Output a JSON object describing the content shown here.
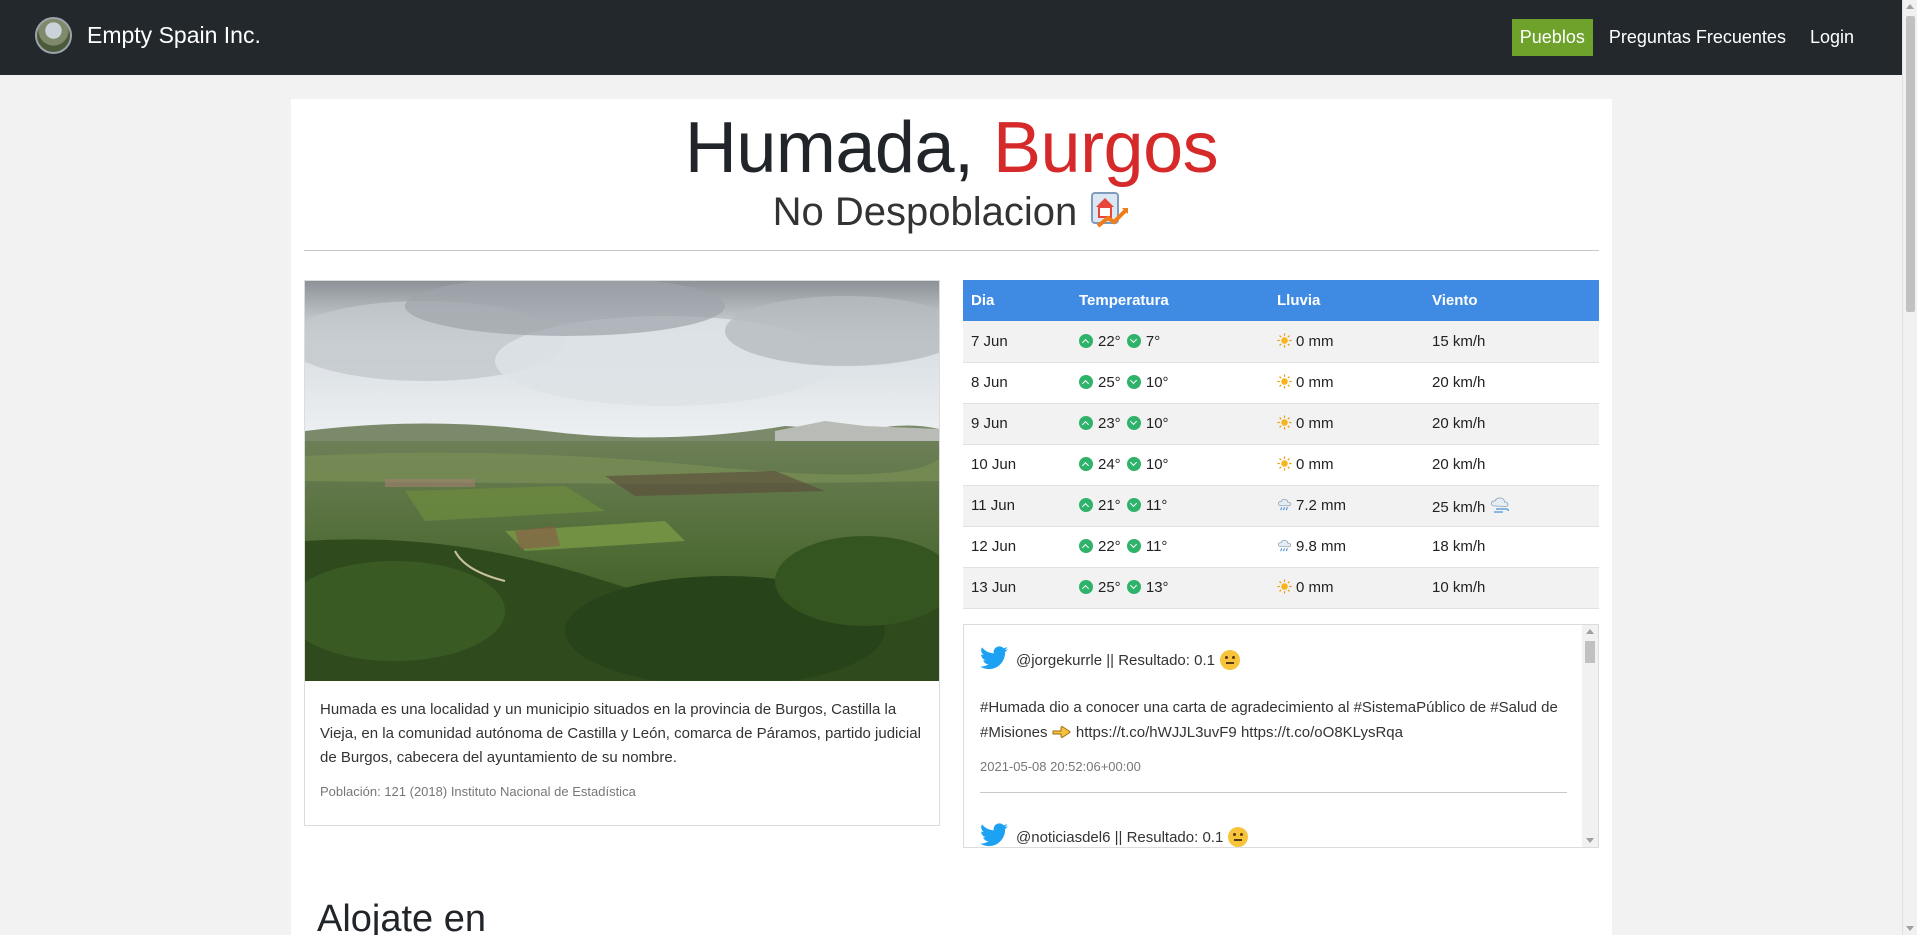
{
  "nav": {
    "brand": "Empty Spain Inc.",
    "links": [
      "Pueblos",
      "Preguntas Frecuentes",
      "Login"
    ]
  },
  "town": {
    "name": "Humada,",
    "province": "Burgos",
    "status": "No Despoblacion"
  },
  "card": {
    "description": "Humada es una localidad y un municipio situados en la provincia de Burgos, Castilla la Vieja, en la comunidad autónoma de Castilla y León, comarca de Páramos, partido judicial de Burgos, cabecera del ayuntamiento de su nombre.",
    "population": "Población: 121 (2018) Instituto Nacional de Estadística"
  },
  "weather": {
    "headers": [
      "Dia",
      "Temperatura",
      "Lluvia",
      "Viento"
    ],
    "rows": [
      {
        "day": "7 Jun",
        "max": "22°",
        "min": "7°",
        "rain": "0 mm",
        "rain_icon": "sun-icon",
        "wind": "15 km/h",
        "wind_icon": ""
      },
      {
        "day": "8 Jun",
        "max": "25°",
        "min": "10°",
        "rain": "0 mm",
        "rain_icon": "sun-icon",
        "wind": "20 km/h",
        "wind_icon": ""
      },
      {
        "day": "9 Jun",
        "max": "23°",
        "min": "10°",
        "rain": "0 mm",
        "rain_icon": "sun-icon",
        "wind": "20 km/h",
        "wind_icon": ""
      },
      {
        "day": "10 Jun",
        "max": "24°",
        "min": "10°",
        "rain": "0 mm",
        "rain_icon": "sun-icon",
        "wind": "20 km/h",
        "wind_icon": ""
      },
      {
        "day": "11 Jun",
        "max": "21°",
        "min": "11°",
        "rain": "7.2 mm",
        "rain_icon": "rain-cloud-icon",
        "wind": "25 km/h",
        "wind_icon": "wind-cloud-icon"
      },
      {
        "day": "12 Jun",
        "max": "22°",
        "min": "11°",
        "rain": "9.8 mm",
        "rain_icon": "rain-cloud-icon",
        "wind": "18 km/h",
        "wind_icon": ""
      },
      {
        "day": "13 Jun",
        "max": "25°",
        "min": "13°",
        "rain": "0 mm",
        "rain_icon": "sun-icon",
        "wind": "10 km/h",
        "wind_icon": ""
      }
    ]
  },
  "tweets": [
    {
      "user": "@jorgekurrle || Resultado: 0.1",
      "text_before": "#Humada dio a conocer una carta de agradecimiento al #SistemaPúblico de #Salud de #Misiones",
      "text_after": "https://t.co/hWJJL3uvF9 https://t.co/oO8KLysRqa",
      "time": "2021-05-08 20:52:06+00:00"
    },
    {
      "user": "@noticiasdel6 || Resultado: 0.1",
      "text_before": "",
      "text_after": "",
      "time": ""
    }
  ],
  "section": {
    "alojate": "Alojate en"
  },
  "colors": {
    "navbar": "#23282d",
    "nav_active": "#6ea22a",
    "province": "#d62a2a",
    "table_header": "#3f8be4",
    "twitter": "#1da1f2"
  }
}
